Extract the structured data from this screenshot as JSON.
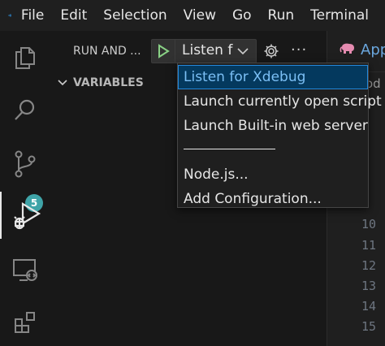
{
  "menubar": {
    "items": [
      "File",
      "Edit",
      "Selection",
      "View",
      "Go",
      "Run",
      "Terminal"
    ]
  },
  "activity_bar": {
    "source_control_badge": "5"
  },
  "sidebar": {
    "title": "RUN AND ...",
    "config_selected": "Listen f",
    "variables_label": "VARIABLES"
  },
  "editor": {
    "tab_label": "App",
    "breadcrumb": "od",
    "line_numbers": [
      "10",
      "11",
      "12",
      "13",
      "14",
      "15"
    ]
  },
  "dropdown": {
    "items": [
      "Listen for Xdebug",
      "Launch currently open script",
      "Launch Built-in web server",
      "Node.js...",
      "Add Configuration..."
    ],
    "separator": "──────────────"
  },
  "colors": {
    "accent": "#2488db",
    "run_green": "#89d185",
    "badge": "#3fa4a8"
  }
}
